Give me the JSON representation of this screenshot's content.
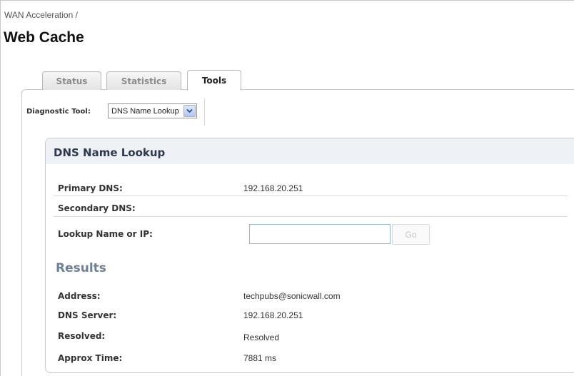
{
  "breadcrumb": "WAN Acceleration /",
  "page_title": "Web Cache",
  "tabs": [
    {
      "label": "Status",
      "active": false
    },
    {
      "label": "Statistics",
      "active": false
    },
    {
      "label": "Tools",
      "active": true
    }
  ],
  "diagnostic_tool": {
    "label": "Diagnostic Tool:",
    "selected": "DNS Name Lookup",
    "arrow_icon": "chevron-down-icon"
  },
  "panel": {
    "title": "DNS Name Lookup",
    "primary_dns": {
      "label": "Primary DNS:",
      "value": "192.168.20.251"
    },
    "secondary_dns": {
      "label": "Secondary DNS:",
      "value": ""
    },
    "lookup": {
      "label": "Lookup Name or IP:",
      "value": "",
      "go_label": "Go"
    }
  },
  "results": {
    "heading": "Results",
    "address": {
      "label": "Address:",
      "value": "techpubs@sonicwall.com"
    },
    "dns_server": {
      "label": "DNS Server:",
      "value": "192.168.20.251"
    },
    "resolved": {
      "label": "Resolved:",
      "value": "Resolved"
    },
    "approx_time": {
      "label": "Approx Time:",
      "value": "7881 ms"
    }
  },
  "colors": {
    "results_heading": "#6f8197",
    "panel_header_bg": "#eef1f5",
    "select_border": "#7f9db9"
  }
}
